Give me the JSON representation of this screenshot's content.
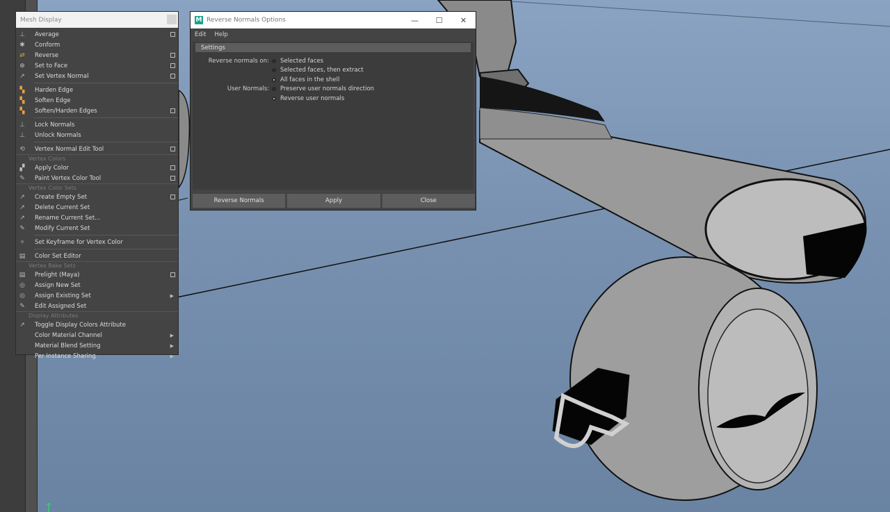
{
  "mesh_menu": {
    "title": "Mesh Display",
    "sections": {
      "vertex_colors": "Vertex Colors",
      "vertex_color_sets": "Vertex Color Sets",
      "vertex_bake_sets": "Vertex Bake Sets",
      "display_attributes": "Display Attributes"
    },
    "items": [
      {
        "label": "Average",
        "icon": "average-icon"
      },
      {
        "label": "Conform",
        "icon": "conform-icon"
      },
      {
        "label": "Reverse",
        "icon": "reverse-icon"
      },
      {
        "label": "Set to Face",
        "icon": "set-to-face-icon"
      },
      {
        "label": "Set Vertex Normal",
        "icon": "set-vertex-normal-icon"
      },
      {
        "label": "Harden Edge",
        "icon": "harden-edge-icon"
      },
      {
        "label": "Soften Edge",
        "icon": "soften-edge-icon"
      },
      {
        "label": "Soften/Harden Edges",
        "icon": "soften-harden-icon"
      },
      {
        "label": "Lock Normals",
        "icon": "lock-normals-icon"
      },
      {
        "label": "Unlock Normals",
        "icon": "unlock-normals-icon"
      },
      {
        "label": "Vertex Normal Edit Tool",
        "icon": "vertex-normal-edit-icon"
      },
      {
        "label": "Apply Color",
        "icon": "apply-color-icon"
      },
      {
        "label": "Paint Vertex Color Tool",
        "icon": "paint-vertex-color-icon"
      },
      {
        "label": "Create Empty Set",
        "icon": "create-empty-set-icon"
      },
      {
        "label": "Delete Current Set",
        "icon": "delete-current-set-icon"
      },
      {
        "label": "Rename Current Set...",
        "icon": "rename-current-set-icon"
      },
      {
        "label": "Modify Current Set",
        "icon": "modify-current-set-icon"
      },
      {
        "label": "Set Keyframe for Vertex Color",
        "icon": "set-keyframe-icon"
      },
      {
        "label": "Color Set Editor",
        "icon": "color-set-editor-icon"
      },
      {
        "label": "Prelight (Maya)",
        "icon": "prelight-icon"
      },
      {
        "label": "Assign New Set",
        "icon": "assign-new-set-icon"
      },
      {
        "label": "Assign Existing Set",
        "icon": "assign-existing-set-icon"
      },
      {
        "label": "Edit Assigned Set",
        "icon": "edit-assigned-set-icon"
      },
      {
        "label": "Toggle Display Colors Attribute",
        "icon": "toggle-display-colors-icon"
      },
      {
        "label": "Color Material Channel",
        "icon": ""
      },
      {
        "label": "Material Blend Setting",
        "icon": ""
      },
      {
        "label": "Per Instance Sharing",
        "icon": ""
      }
    ]
  },
  "dialog": {
    "title": "Reverse Normals Options",
    "menu": {
      "edit": "Edit",
      "help": "Help"
    },
    "settings_header": "Settings",
    "reverse_label": "Reverse normals on:",
    "reverse_options": [
      "Selected faces",
      "Selected faces, then extract",
      "All faces in the shell"
    ],
    "reverse_selected": "All faces in the shell",
    "user_label": "User Normals:",
    "user_options": [
      "Preserve user normals direction",
      "Reverse user normals"
    ],
    "user_selected": "Reverse user normals",
    "buttons": {
      "reverse": "Reverse Normals",
      "apply": "Apply",
      "close": "Close"
    },
    "window_controls": {
      "minimize": "—",
      "maximize": "☐",
      "close": "✕"
    }
  },
  "colors": {
    "viewport_sky": "#7f98b8",
    "menu_bg": "#444444",
    "maya_logo": "#18a58a"
  }
}
